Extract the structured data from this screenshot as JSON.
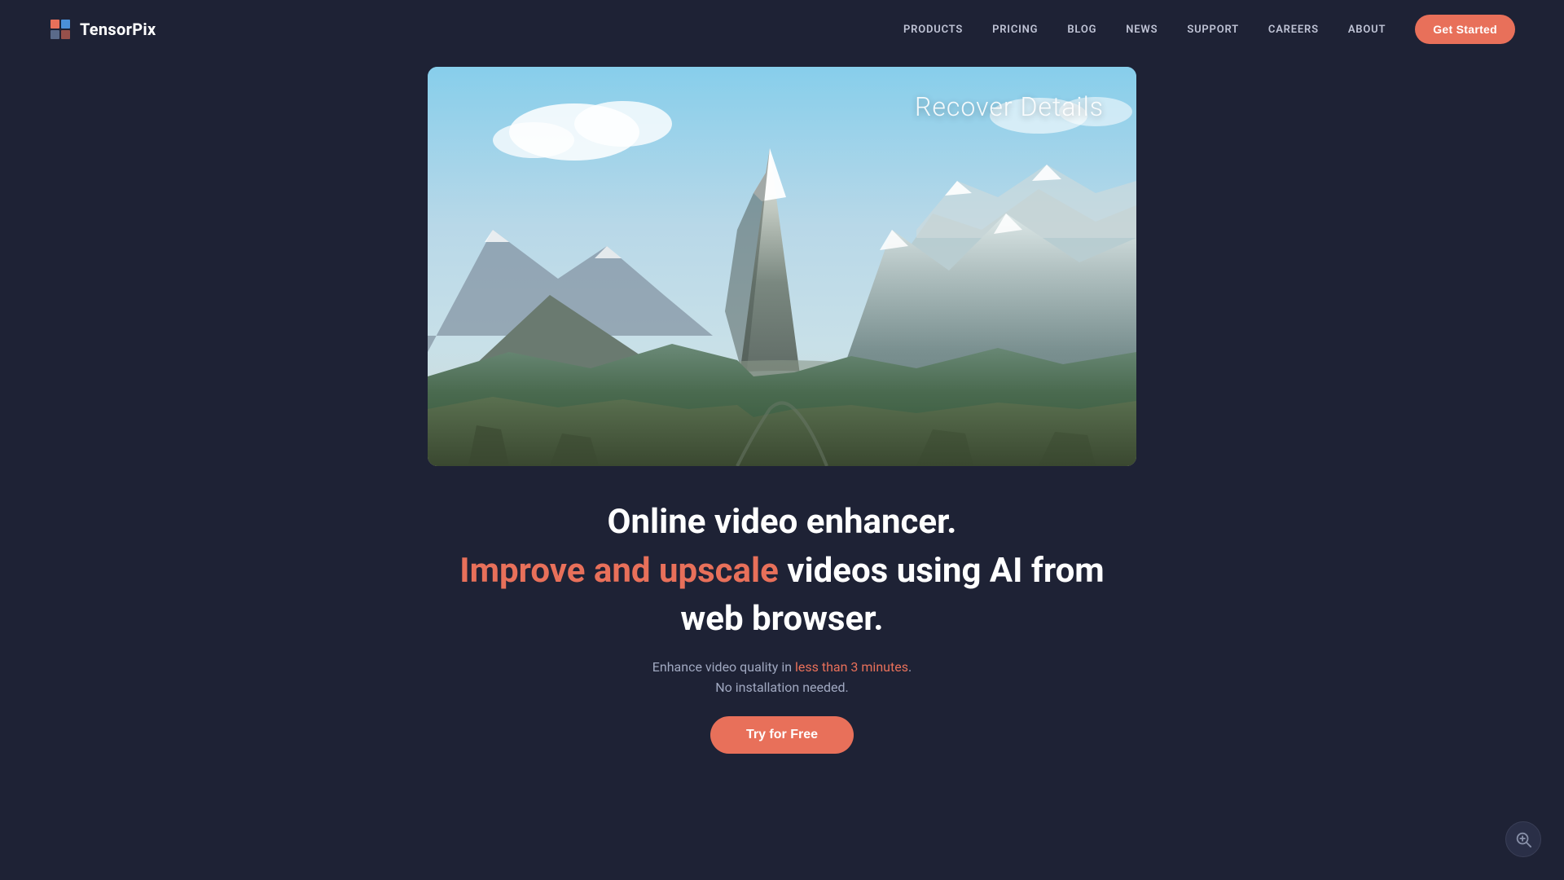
{
  "brand": {
    "name": "TensorPix",
    "logo_icon": "T"
  },
  "nav": {
    "links": [
      {
        "id": "products",
        "label": "PRODUCTS"
      },
      {
        "id": "pricing",
        "label": "PRICING"
      },
      {
        "id": "blog",
        "label": "BLOG"
      },
      {
        "id": "news",
        "label": "NEWS"
      },
      {
        "id": "support",
        "label": "SUPPORT"
      },
      {
        "id": "careers",
        "label": "CAREERS"
      },
      {
        "id": "about",
        "label": "ABOUT"
      }
    ],
    "cta_label": "Get Started"
  },
  "video": {
    "overlay_text": "Recover Details"
  },
  "hero": {
    "title": "Online video enhancer.",
    "subtitle_part1": "Improve and upscale",
    "subtitle_part2": " videos using AI from",
    "subtitle_line2": "web browser.",
    "description_part1": "Enhance video quality in ",
    "description_highlight": "less than 3 minutes",
    "description_part2": ".",
    "description_line2": "No installation needed.",
    "cta_label": "Try for Free"
  },
  "colors": {
    "accent": "#e8705a",
    "background": "#1e2235",
    "nav_text": "#c0c4d6",
    "body_text": "#a0a8c0"
  }
}
